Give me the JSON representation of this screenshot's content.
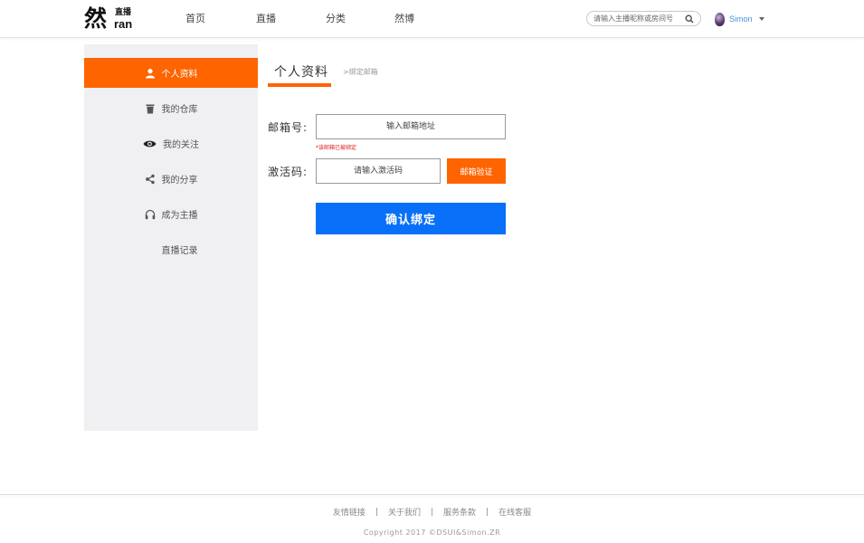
{
  "brand": {
    "logo_main": "然",
    "logo_sub": "直播",
    "logo_en": "ran"
  },
  "nav": {
    "items": [
      "首页",
      "直播",
      "分类",
      "然博"
    ]
  },
  "search": {
    "placeholder": "请输入主播昵称或房间号",
    "icon": "search-icon"
  },
  "user": {
    "name": "Simon",
    "icon": "avatar"
  },
  "sidebar": {
    "items": [
      {
        "label": "个人资料",
        "icon": "user-icon",
        "active": true
      },
      {
        "label": "我的仓库",
        "icon": "trash-icon"
      },
      {
        "label": "我的关注",
        "icon": "eye-icon"
      },
      {
        "label": "我的分享",
        "icon": "share-icon"
      },
      {
        "label": "成为主播",
        "icon": "headphones-icon"
      },
      {
        "label": "直播记录",
        "icon": ""
      }
    ]
  },
  "main": {
    "tab_title": "个人资料",
    "breadcrumb": ">绑定邮箱",
    "email_label": "邮箱号:",
    "email_placeholder": "输入邮箱地址",
    "email_warning": "*该邮箱已被绑定",
    "code_label": "激活码:",
    "code_placeholder": "请输入激活码",
    "verify_button": "邮箱验证",
    "confirm_button": "确认绑定"
  },
  "footer": {
    "links": [
      "友情链接",
      "关于我们",
      "服务条款",
      "在线客服"
    ],
    "separator": "|",
    "copyright": "Copyright 2017 ©DSUI&Simon.ZR"
  },
  "colors": {
    "accent": "#fe6400",
    "primary_button": "#0870f8",
    "sidebar_bg": "#f0f0f2",
    "warning": "#e02020"
  }
}
